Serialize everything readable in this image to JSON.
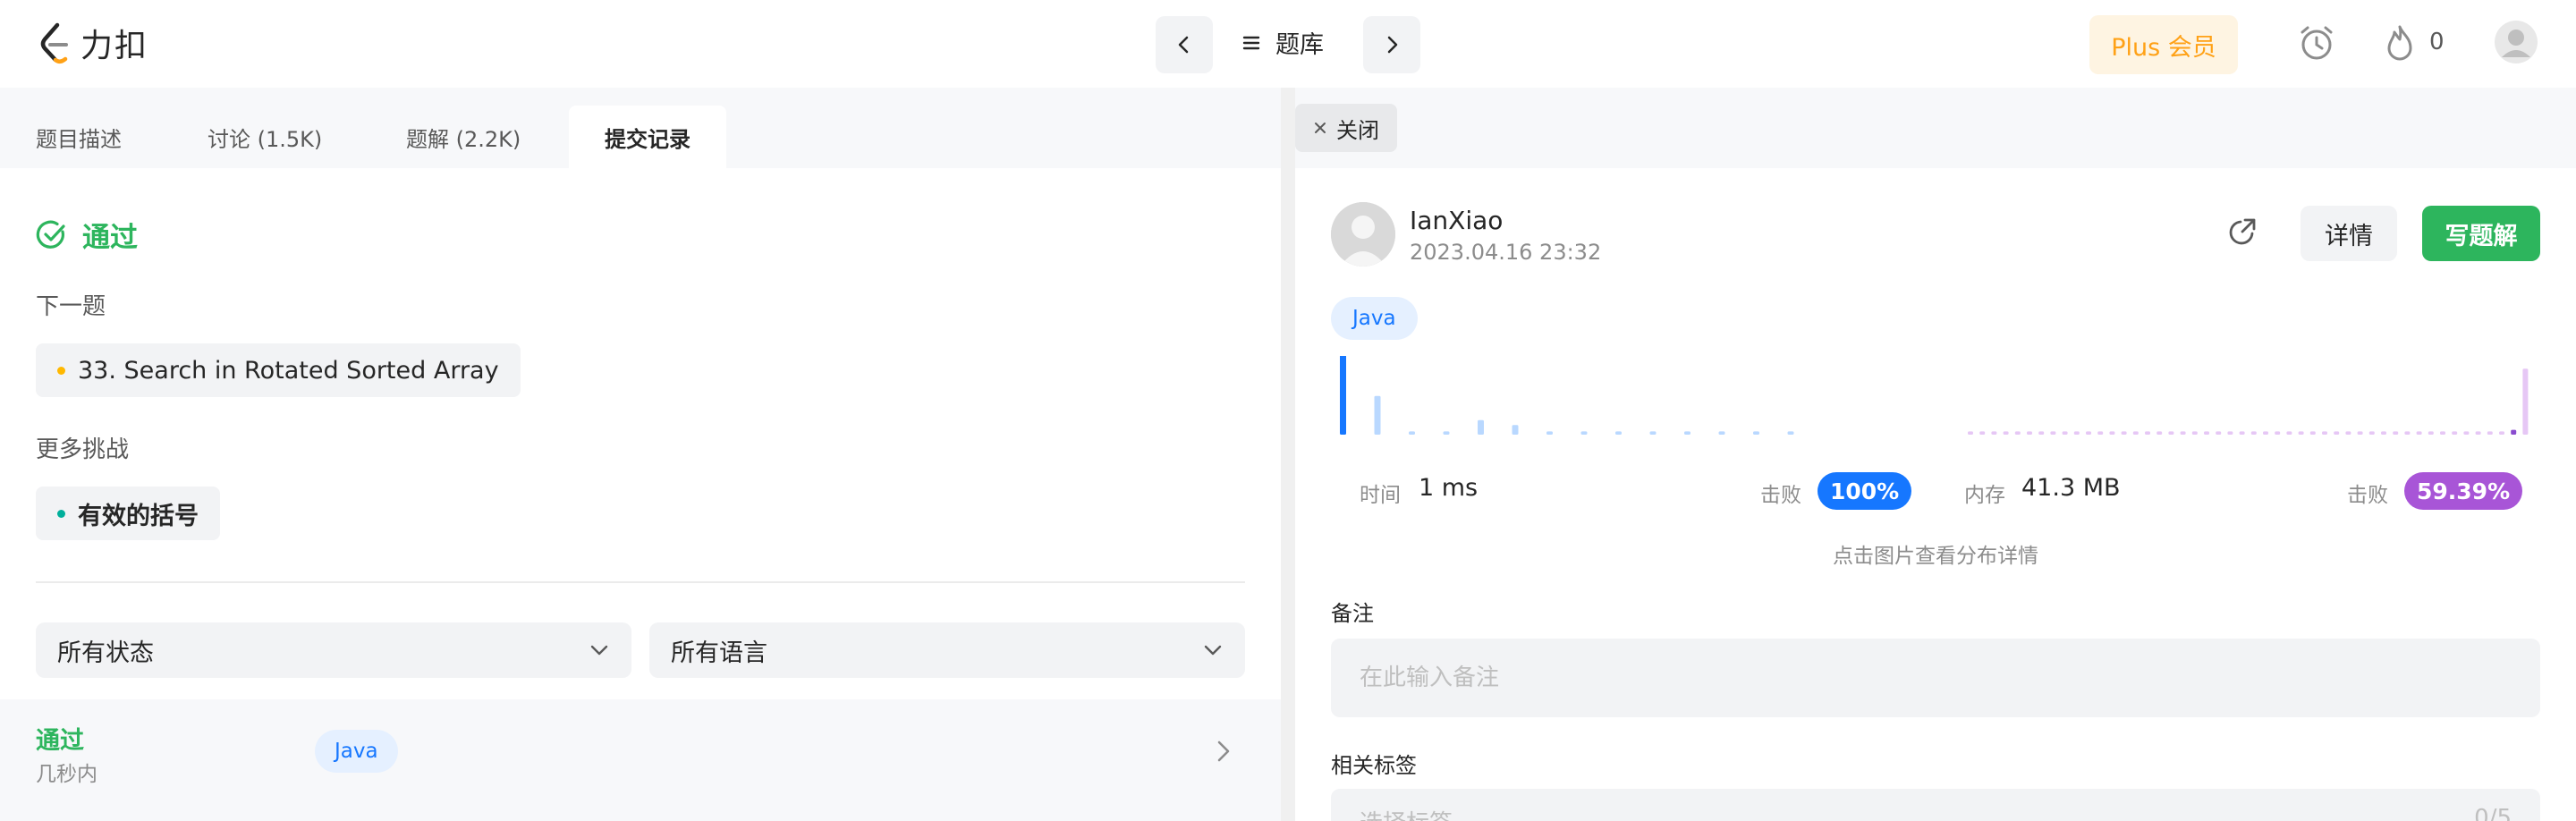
{
  "brand": {
    "logo_text": "力扣",
    "accent": "#ffa116"
  },
  "topnav": {
    "prev_icon": "chevron-left-icon",
    "list_icon": "list-icon",
    "problem_bank_label": "题库",
    "next_icon": "chevron-right-icon",
    "plus_label": "Plus 会员",
    "alarm_icon": "alarm-clock-icon",
    "streak_icon": "fire-icon",
    "streak_count": "0",
    "avatar_icon": "user-avatar-icon"
  },
  "left": {
    "tabs": [
      {
        "label": "题目描述",
        "active": false
      },
      {
        "label": "讨论 (1.5K)",
        "active": false
      },
      {
        "label": "题解 (2.2K)",
        "active": false
      },
      {
        "label": "提交记录",
        "active": true
      }
    ],
    "result": {
      "status": "通过",
      "icon": "check-circle-icon",
      "color": "#2db55d"
    },
    "next_problem": {
      "label": "下一题",
      "title": "33. Search in Rotated Sorted Array",
      "difficulty_color": "#ffb800"
    },
    "more_challenges": {
      "label": "更多挑战",
      "title": "有效的括号",
      "difficulty_color": "#00af9b"
    },
    "filters": {
      "status": "所有状态",
      "language": "所有语言"
    },
    "submissions": [
      {
        "status": "通过",
        "time": "几秒内",
        "language": "Java"
      }
    ]
  },
  "right": {
    "close_label": "关闭",
    "user": {
      "name": "IanXiao",
      "submitted_at": "2023.04.16 23:32"
    },
    "share_icon": "share-icon",
    "detail_label": "详情",
    "write_solution_label": "写题解",
    "language": "Java",
    "runtime": {
      "label": "时间",
      "value": "1 ms",
      "beats_label": "击败",
      "beats_value": "100%",
      "color": "#1677ff"
    },
    "memory": {
      "label": "内存",
      "value": "41.3 MB",
      "beats_label": "击败",
      "beats_value": "59.39%",
      "color": "#a855d7"
    },
    "chart_hint": "点击图片查看分布详情",
    "note": {
      "label": "备注",
      "placeholder": "在此输入备注"
    },
    "tags": {
      "label": "相关标签",
      "placeholder": "选择标签",
      "count": "0/5"
    }
  },
  "chart_data": [
    {
      "type": "bar",
      "title": "",
      "xlabel": "",
      "ylabel": "",
      "series": [
        {
          "values": [
            1.0,
            0.48,
            0.04,
            0.04,
            0.18,
            0.12,
            0.04,
            0.04,
            0.04,
            0.04,
            0.04,
            0.04,
            0.04,
            0.04
          ]
        }
      ],
      "highlight_index": 0,
      "ylim": [
        0,
        1
      ]
    },
    {
      "type": "bar",
      "title": "",
      "xlabel": "",
      "ylabel": "",
      "series": [
        {
          "values": [
            0.04,
            0.04,
            0.04,
            0.04,
            0.04,
            0.04,
            0.04,
            0.04,
            0.04,
            0.04,
            0.04,
            0.04,
            0.04,
            0.04,
            0.04,
            0.04,
            0.04,
            0.04,
            0.04,
            0.04,
            0.04,
            0.04,
            0.04,
            0.04,
            0.04,
            0.04,
            0.04,
            0.04,
            0.04,
            0.04,
            0.04,
            0.04,
            0.04,
            0.04,
            0.04,
            0.04,
            0.04,
            0.04,
            0.04,
            0.04,
            0.04,
            0.04,
            0.04,
            0.04,
            0.04,
            0.04,
            0.06,
            0.82
          ]
        }
      ],
      "highlight_index": 46,
      "ylim": [
        0,
        1
      ]
    }
  ]
}
